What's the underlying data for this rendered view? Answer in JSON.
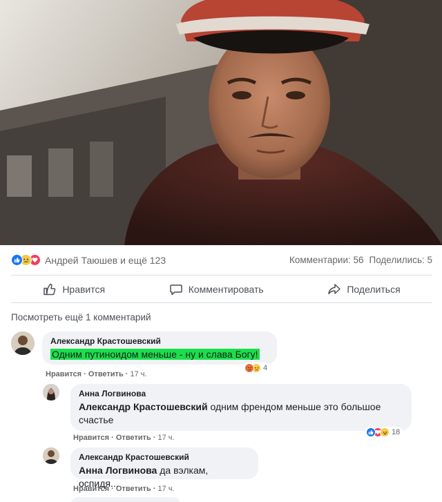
{
  "post": {
    "reactions": {
      "icons": [
        "like-icon",
        "sad-icon",
        "love-icon"
      ],
      "names": "Андрей Таюшев и ещё 123",
      "comments_label": "Комментарии: 56",
      "shares_label": "Поделились: 5"
    },
    "actions": {
      "like": "Нравится",
      "comment": "Комментировать",
      "share": "Поделиться"
    },
    "view_more": "Посмотреть ещё 1 комментарий"
  },
  "comments": [
    {
      "author": "Александр Крастошевский",
      "text": "Одним путиноидом меньше - ну и слава Богу!",
      "like": "Нравится",
      "reply": "Ответить",
      "time": "17 ч.",
      "reaction_icons": [
        "angry-icon",
        "sad-icon"
      ],
      "reaction_count": "4"
    },
    {
      "author": "Анна Логвинова",
      "mention": "Александр Крастошевский",
      "text": "одним френдом меньше это большое",
      "text2": "счастье",
      "like": "Нравится",
      "reply": "Ответить",
      "time": "17 ч.",
      "reaction_icons": [
        "like-icon",
        "love-icon",
        "haha-icon"
      ],
      "reaction_count": "18"
    },
    {
      "author": "Александр Крастошевский",
      "mention": "Анна Логвинова",
      "text": "да вэлкам, оспидя...",
      "like": "Нравится",
      "reply": "Ответить",
      "time": "17 ч."
    }
  ],
  "separator": " · "
}
